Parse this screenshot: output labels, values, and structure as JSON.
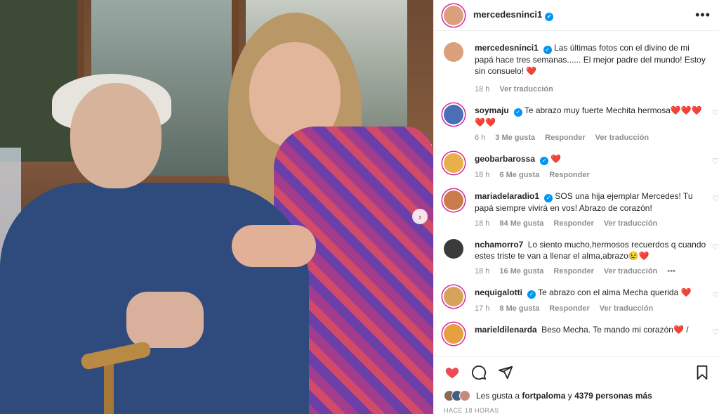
{
  "post": {
    "username": "mercedesninci1",
    "caption": "Las últimas fotos con el divino de mi papá hace tres semanas...... El mejor padre del mundo! Estoy sin consuelo! ❤️",
    "caption_time": "18 h",
    "caption_translate": "Ver traducción",
    "next_icon": "chevron-right-icon"
  },
  "comments": [
    {
      "user": "soymaju",
      "verified": true,
      "text": "Te abrazo muy fuerte Mechita hermosa❤️❤️❤️❤️❤️",
      "time": "6 h",
      "likes": "3 Me gusta",
      "reply": "Responder",
      "translate": "Ver traducción",
      "avatar_color": "#4a6fb5"
    },
    {
      "user": "geobarbarossa",
      "verified": true,
      "text": "❤️",
      "time": "18 h",
      "likes": "6 Me gusta",
      "reply": "Responder",
      "translate": "",
      "avatar_color": "#e8b04a"
    },
    {
      "user": "mariadelaradio1",
      "verified": true,
      "text": "SOS una hija ejemplar Mercedes! Tu papá siempre vivirá en vos! Abrazo de corazón!",
      "time": "18 h",
      "likes": "84 Me gusta",
      "reply": "Responder",
      "translate": "Ver traducción",
      "avatar_color": "#c97b4e"
    },
    {
      "user": "nchamorro7",
      "verified": false,
      "text": "Lo siento mucho,hermosos recuerdos q cuando estes triste te van a llenar el alma,abrazo😢❤️",
      "time": "18 h",
      "likes": "16 Me gusta",
      "reply": "Responder",
      "translate": "Ver traducción",
      "more": "•••",
      "avatar_color": "#3b3b3b"
    },
    {
      "user": "nequigalotti",
      "verified": true,
      "text": "Te abrazo con el alma Mecha querida ❤️",
      "time": "17 h",
      "likes": "8 Me gusta",
      "reply": "Responder",
      "translate": "Ver traducción",
      "avatar_color": "#d7a35c"
    },
    {
      "user": "marieldilenarda",
      "verified": false,
      "text": "Beso Mecha. Te mando mi corazón❤️ /",
      "time": "",
      "likes": "",
      "reply": "",
      "translate": "",
      "avatar_color": "#e6a03f"
    }
  ],
  "likes_line": {
    "prefix": "Les gusta a",
    "user": "fortpaloma",
    "middle": "y",
    "count": "4379 personas más"
  },
  "timestamp": "HACE 18 HORAS",
  "colors": {
    "heart": "#ed4956",
    "verified": "#0095f6"
  }
}
